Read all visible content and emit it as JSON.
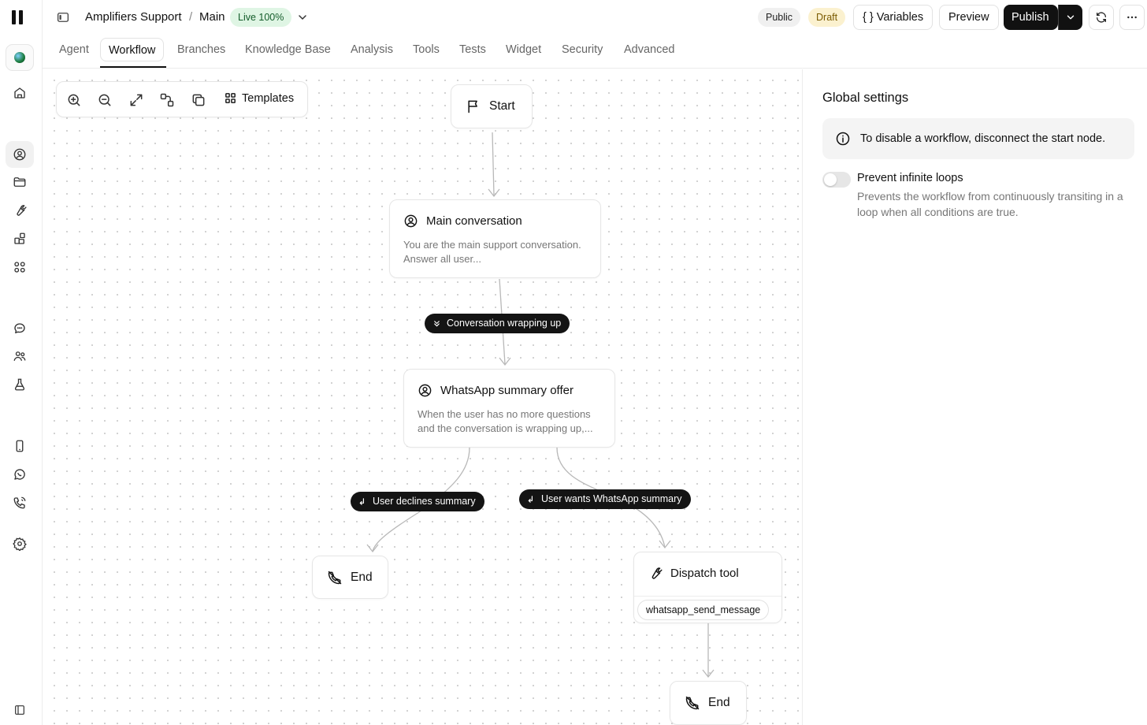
{
  "breadcrumb": {
    "agent": "Amplifiers Support",
    "separator": "/",
    "branch": "Main",
    "live_badge": "Live 100%"
  },
  "header": {
    "public_badge": "Public",
    "draft_badge": "Draft",
    "variables_label": "{ } Variables",
    "preview_label": "Preview",
    "publish_label": "Publish"
  },
  "tabs": [
    {
      "label": "Agent"
    },
    {
      "label": "Workflow"
    },
    {
      "label": "Branches"
    },
    {
      "label": "Knowledge Base"
    },
    {
      "label": "Analysis"
    },
    {
      "label": "Tools"
    },
    {
      "label": "Tests"
    },
    {
      "label": "Widget"
    },
    {
      "label": "Security"
    },
    {
      "label": "Advanced"
    }
  ],
  "active_tab": "Workflow",
  "toolbar": {
    "templates_label": "Templates",
    "icons": [
      "zoom-in-icon",
      "zoom-out-icon",
      "fit-view-icon",
      "auto-layout-icon",
      "copy-icon",
      "grid-icon"
    ]
  },
  "nodes": {
    "start": {
      "label": "Start"
    },
    "main": {
      "title": "Main conversation",
      "desc": "You are the main support conversation. Answer all user..."
    },
    "whatsapp": {
      "title": "WhatsApp summary offer",
      "desc": "When the user has no more questions and the conversation is wrapping up,..."
    },
    "end1": {
      "label": "End"
    },
    "dispatch": {
      "title": "Dispatch tool",
      "tool": "whatsapp_send_message"
    },
    "end2": {
      "label": "End"
    }
  },
  "edges": {
    "wrapping_up": "Conversation wrapping up",
    "declines": "User declines summary",
    "wants": "User wants WhatsApp summary"
  },
  "global_settings": {
    "title": "Global settings",
    "info": "To disable a workflow, disconnect the start node.",
    "option_title": "Prevent infinite loops",
    "option_desc": "Prevents the workflow from continuously transiting in a loop when all conditions are true.",
    "option_enabled": false
  },
  "colors": {
    "accent": "#111111",
    "live_bg": "#dff5e4",
    "draft_bg": "#fbf1cf"
  }
}
